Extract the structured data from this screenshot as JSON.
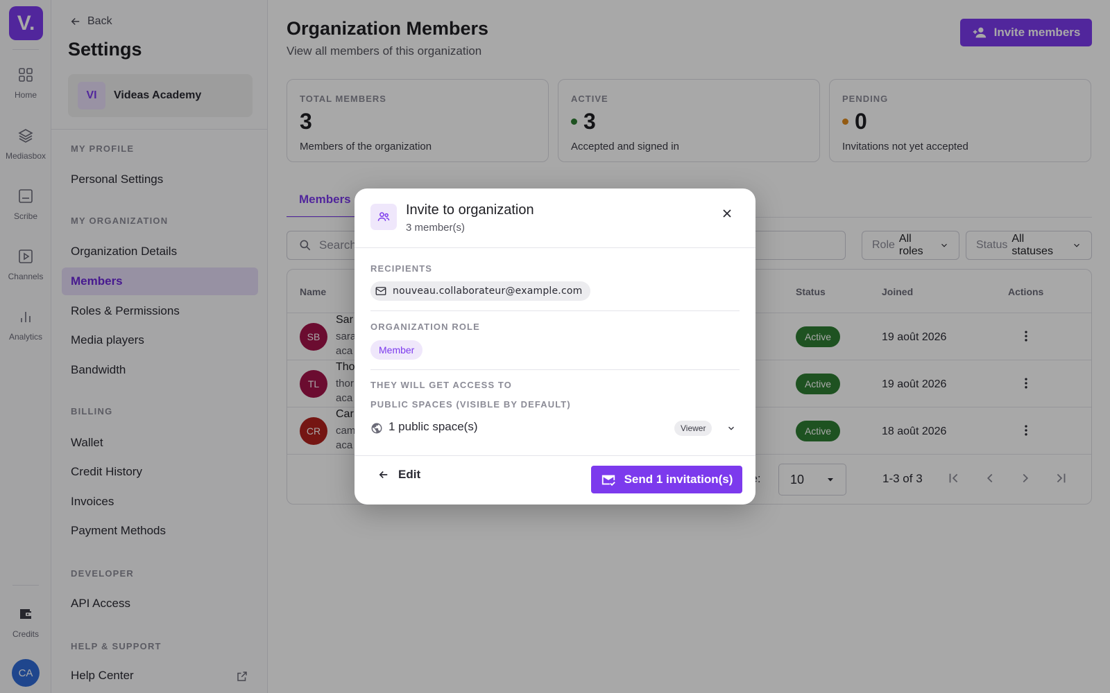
{
  "rail": {
    "logo": "V.",
    "items": [
      {
        "label": "Home",
        "icon": "grid-icon"
      },
      {
        "label": "Mediasbox",
        "icon": "layers-icon"
      },
      {
        "label": "Scribe",
        "icon": "subtitles-icon"
      },
      {
        "label": "Channels",
        "icon": "play-box-icon"
      },
      {
        "label": "Analytics",
        "icon": "bar-chart-icon"
      },
      {
        "label": "Credits",
        "icon": "wallet-icon"
      }
    ],
    "avatar": "CA"
  },
  "sidebar": {
    "back": "Back",
    "title": "Settings",
    "org_initials": "VI",
    "org_name": "Videas Academy",
    "sections": {
      "profile": "MY PROFILE",
      "organization": "MY ORGANIZATION",
      "billing": "BILLING",
      "developer": "DEVELOPER",
      "help": "HELP & SUPPORT"
    },
    "items": {
      "personal": "Personal Settings",
      "org_details": "Organization Details",
      "members": "Members",
      "roles": "Roles & Permissions",
      "media_players": "Media players",
      "bandwidth": "Bandwidth",
      "wallet": "Wallet",
      "credit_history": "Credit History",
      "invoices": "Invoices",
      "payment_methods": "Payment Methods",
      "api_access": "API Access",
      "help_center": "Help Center"
    }
  },
  "main": {
    "title": "Organization Members",
    "subtitle": "View all members of this organization",
    "invite_button": "Invite members",
    "stats": [
      {
        "key": "TOTAL MEMBERS",
        "value": "3",
        "desc": "Members of the organization"
      },
      {
        "key": "ACTIVE",
        "value": "3",
        "desc": "Accepted and signed in",
        "dot_color": "#2e7d32"
      },
      {
        "key": "PENDING",
        "value": "0",
        "desc": "Invitations not yet accepted",
        "dot_color": "#e08a1e"
      }
    ],
    "tab": "Members",
    "search_placeholder": "Search",
    "filters": {
      "role_label": "Role",
      "role_value": "All roles",
      "status_label": "Status",
      "status_value": "All statuses"
    },
    "table": {
      "headers": {
        "name": "Name",
        "status": "Status",
        "joined": "Joined",
        "actions": "Actions"
      },
      "rows": [
        {
          "initials": "SB",
          "name": "Sar",
          "mail1": "sara",
          "mail2": "aca",
          "status": "Active",
          "joined": "19 août 2026",
          "color": "#a3134a"
        },
        {
          "initials": "TL",
          "name": "Tho",
          "mail1": "thor",
          "mail2": "aca",
          "status": "Active",
          "joined": "19 août 2026",
          "color": "#a3134a"
        },
        {
          "initials": "CR",
          "name": "Car",
          "mail1": "cam",
          "mail2": "aca",
          "status": "Active",
          "joined": "18 août 2026",
          "color": "#b2221e"
        }
      ],
      "per_page_label": "page:",
      "per_page_value": "10",
      "range": "1-3 of 3"
    }
  },
  "modal": {
    "title": "Invite to organization",
    "subtitle": "3 member(s)",
    "recipients_label": "RECIPIENTS",
    "recipient_email": "nouveau.collaborateur@example.com",
    "role_label": "ORGANIZATION ROLE",
    "role_value": "Member",
    "access_label": "THEY WILL GET ACCESS TO",
    "public_spaces_label": "PUBLIC SPACES (VISIBLE BY DEFAULT)",
    "public_spaces_value": "1 public space(s)",
    "space_role": "Viewer",
    "edit_button": "Edit",
    "send_button": "Send 1 invitation(s)"
  },
  "colors": {
    "accent": "#7c3aed",
    "active": "#2e7d32",
    "pending": "#e08a1e"
  }
}
